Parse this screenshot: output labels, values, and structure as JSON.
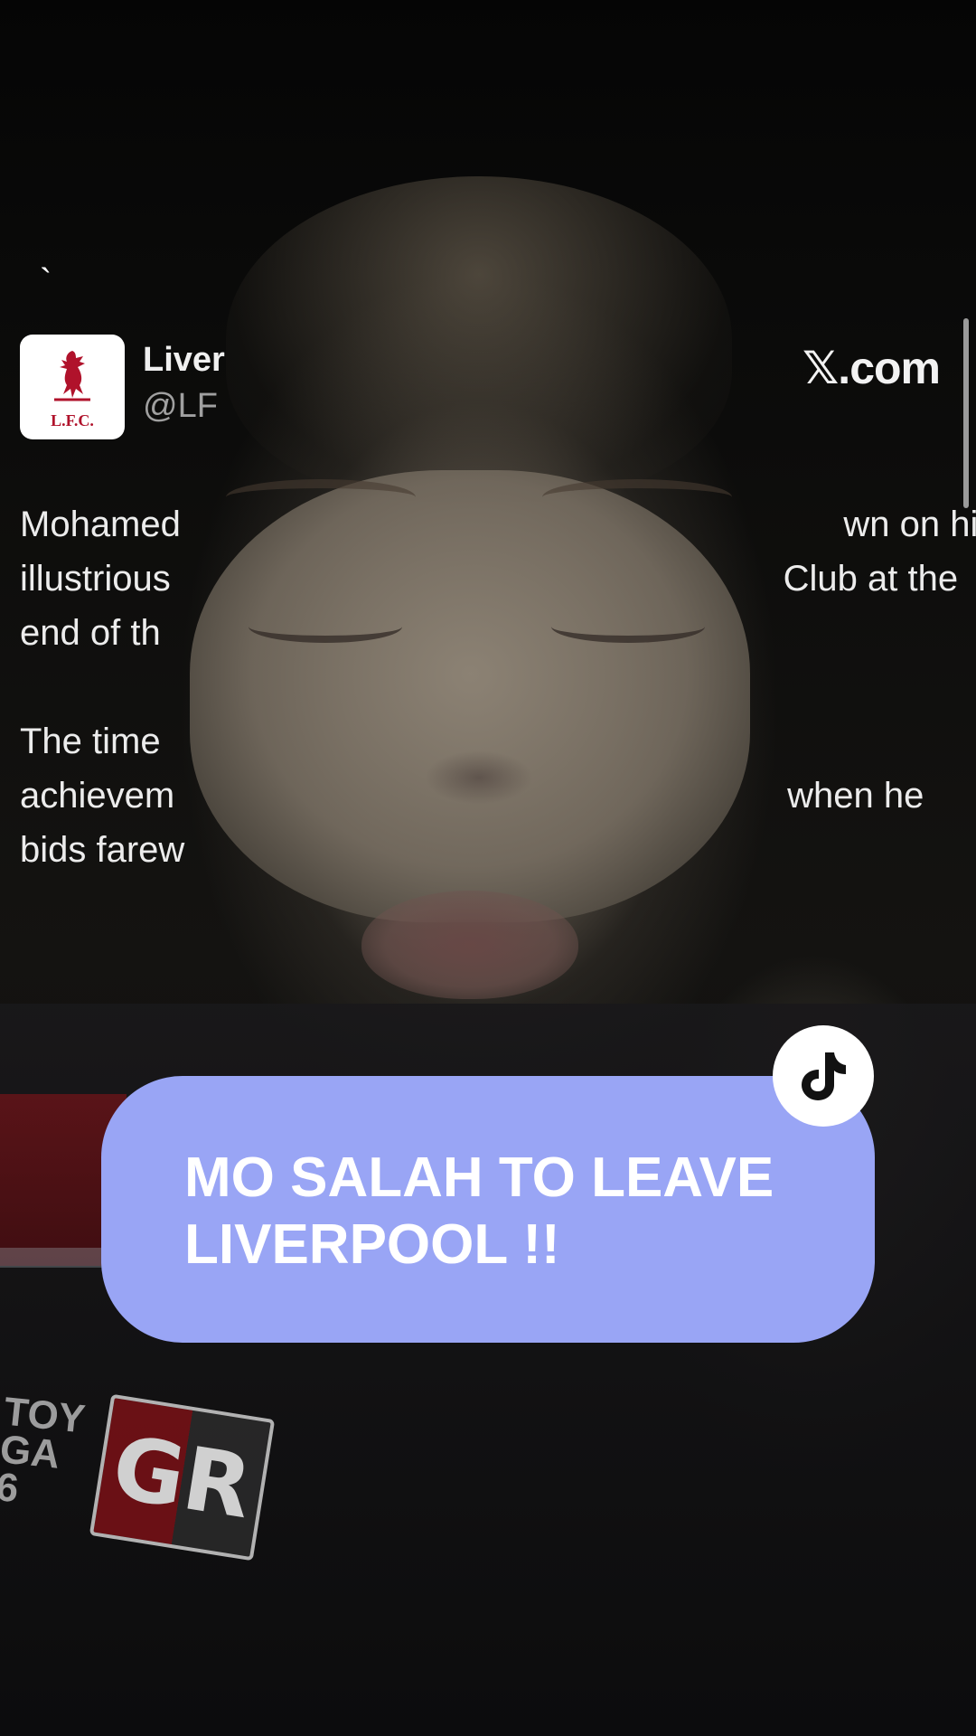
{
  "post": {
    "backtick": "`",
    "account_name": "Liver",
    "account_handle": "@LF",
    "avatar_text": "L.F.C.",
    "brand": "𝕏.com",
    "body_lines": [
      "Mohamed                                                                  wn on his",
      "illustrious                                                             Club at the",
      "end of th",
      "",
      "The time",
      "achievem                                                             when he",
      "bids farew"
    ]
  },
  "caption": {
    "text": "MO SALAH TO LEAVE\nLIVERPOOL !!"
  },
  "background": {
    "shirt_badge": "GR",
    "shirt_text": "TOY\nGA\n6"
  },
  "icons": {
    "tiktok": "tiktok-logo-icon",
    "liverbird": "liverbird-crest-icon"
  },
  "colors": {
    "caption_bg": "#99a5f5",
    "lfc_red": "#b0122b"
  }
}
